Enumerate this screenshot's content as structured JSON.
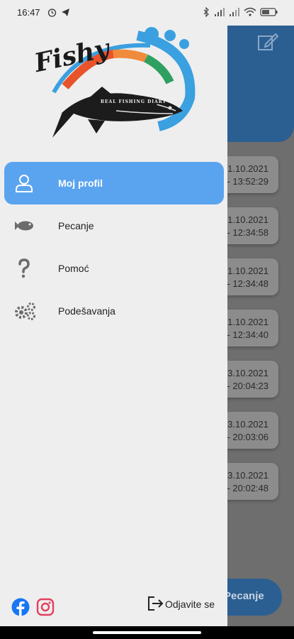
{
  "status_bar": {
    "time": "16:47",
    "left_icons": [
      "alarm-icon",
      "telegram-icon"
    ],
    "right_icons": [
      "bluetooth-icon",
      "signal-icon",
      "wifi-icon",
      "battery-icon"
    ]
  },
  "drawer": {
    "logo": {
      "brand": "Fishy",
      "tagline": "REAL FISHING DIARY"
    },
    "menu": [
      {
        "label": "Moj profil",
        "icon": "user-icon",
        "active": true
      },
      {
        "label": "Pecanje",
        "icon": "fish-icon",
        "active": false
      },
      {
        "label": "Pomoć",
        "icon": "question-icon",
        "active": false
      },
      {
        "label": "Podešavanja",
        "icon": "gears-icon",
        "active": false
      }
    ],
    "social": [
      "facebook-icon",
      "instagram-icon"
    ],
    "logout_label": "Odjavite se"
  },
  "background": {
    "entries": [
      {
        "date": "1.10.2021",
        "time": "- 13:52:29"
      },
      {
        "date": "1.10.2021",
        "time": "- 12:34:58"
      },
      {
        "date": "1.10.2021",
        "time": "- 12:34:48"
      },
      {
        "date": "1.10.2021",
        "time": "- 12:34:40"
      },
      {
        "date": "3.10.2021",
        "time": "- 20:04:23"
      },
      {
        "date": "3.10.2021",
        "time": "- 20:03:06"
      },
      {
        "date": "3.10.2021",
        "time": "- 20:02:48"
      }
    ],
    "fab_label": "Pecanje"
  },
  "colors": {
    "accent": "#5aa4ef",
    "header_dimmed": "#2b5f92",
    "drawer_bg": "#eeeeee"
  }
}
